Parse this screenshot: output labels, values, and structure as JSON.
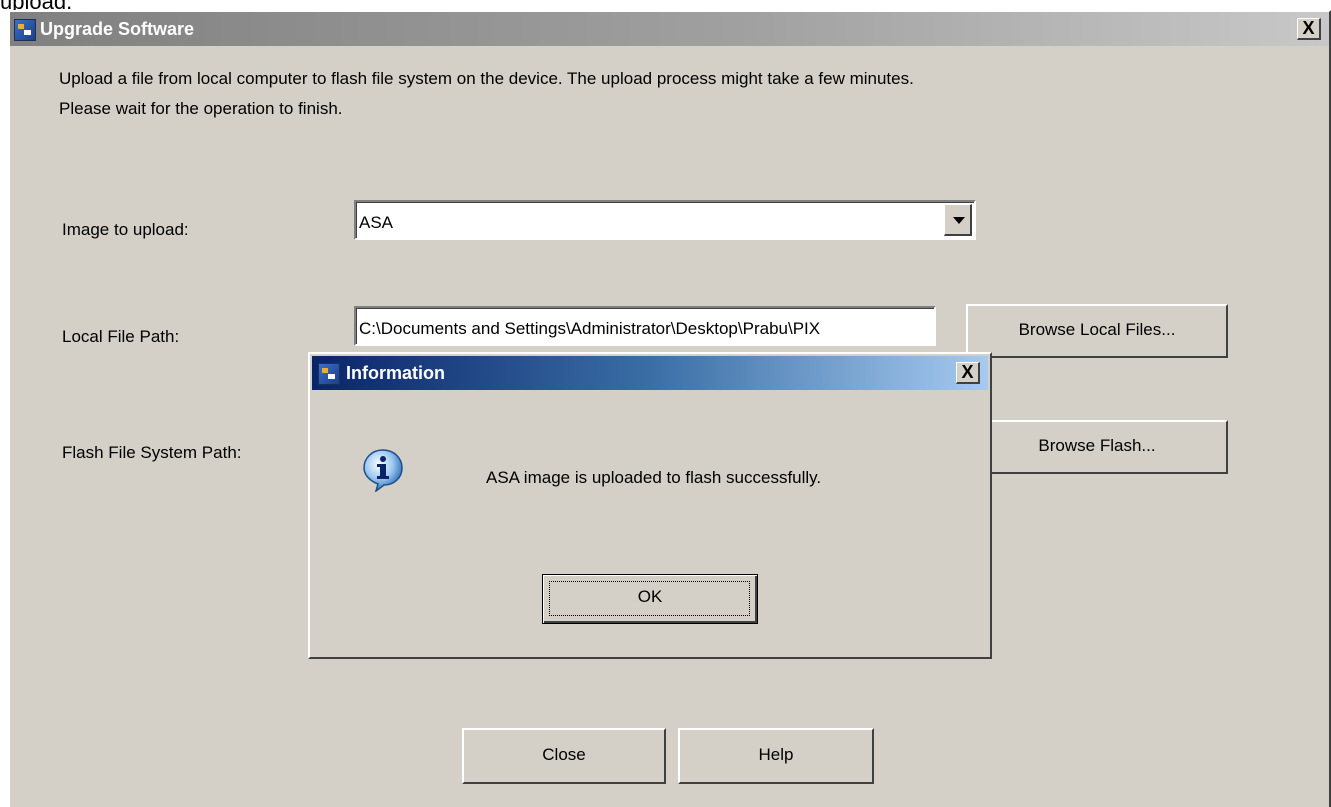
{
  "top_clipped_text": "upload.",
  "window": {
    "title": "Upgrade Software",
    "close_glyph": "X",
    "icon": "cisco-asdm-icon"
  },
  "description": {
    "line1": "Upload a file from local computer to flash file system on the device. The upload process might take a few minutes.",
    "line2": "Please wait for the operation to finish."
  },
  "form": {
    "image_label": "Image to upload:",
    "image_value": "ASA",
    "local_path_label": "Local File Path:",
    "local_path_value": "C:\\Documents and Settings\\Administrator\\Desktop\\Prabu\\PIX",
    "browse_local_label": "Browse Local Files...",
    "flash_path_label": "Flash File System Path:",
    "browse_flash_label": "Browse Flash..."
  },
  "footer": {
    "close_label": "Close",
    "help_label": "Help"
  },
  "dialog": {
    "title": "Information",
    "close_glyph": "X",
    "message": "ASA image is uploaded to flash successfully.",
    "ok_label": "OK",
    "icon": "info-icon"
  }
}
